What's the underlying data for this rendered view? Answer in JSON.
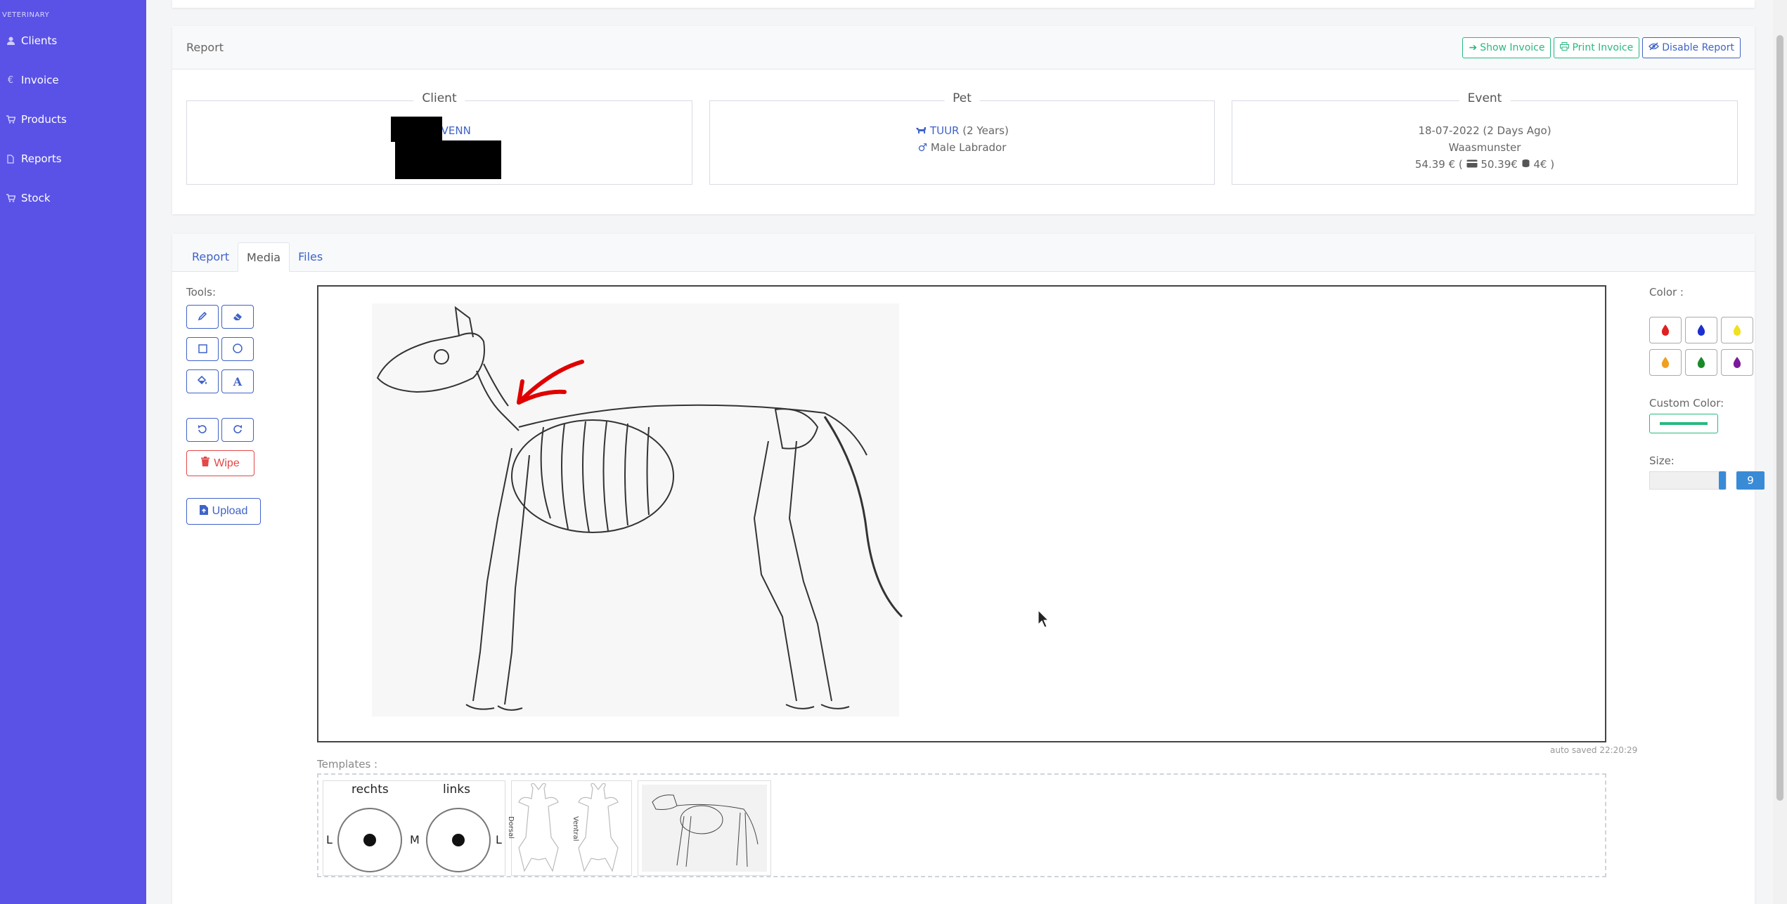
{
  "sidebar": {
    "brand": "VETERINARY",
    "items": [
      {
        "label": "Clients",
        "icon": "user-icon"
      },
      {
        "label": "Invoice",
        "icon": "euro-icon"
      },
      {
        "label": "Products",
        "icon": "cart-icon"
      },
      {
        "label": "Reports",
        "icon": "file-icon"
      },
      {
        "label": "Stock",
        "icon": "cart-icon"
      }
    ]
  },
  "report_card": {
    "title": "Report",
    "buttons": {
      "show_invoice": "Show Invoice",
      "print_invoice": "Print Invoice",
      "disable_report": "Disable Report"
    },
    "client": {
      "legend": "Client",
      "name": "SVENN"
    },
    "pet": {
      "legend": "Pet",
      "name": "TUUR",
      "age": "(2 Years)",
      "description": "Male Labrador"
    },
    "event": {
      "legend": "Event",
      "date": "18-07-2022 (2 Days Ago)",
      "location": "Waasmunster",
      "total": "54.39 €",
      "paid_card": "50.39€",
      "paid_cash": "4€"
    }
  },
  "tabs": [
    "Report",
    "Media",
    "Files"
  ],
  "active_tab": "Media",
  "tools": {
    "label": "Tools:",
    "wipe": "Wipe",
    "upload": "Upload"
  },
  "canvas": {
    "auto_saved": "auto saved 22:20:29"
  },
  "templates": {
    "label": "Templates :",
    "eye_template": {
      "right": "rechts",
      "left": "links",
      "l1": "L",
      "m": "M",
      "l2": "L"
    },
    "body_template": {
      "dorsal": "Dorsal",
      "ventral": "Ventral"
    }
  },
  "colors": {
    "label": "Color :",
    "swatches": [
      "#e02020",
      "#1c2fd0",
      "#f0e020",
      "#f0a020",
      "#1a8a2a",
      "#7a1a9a"
    ],
    "custom_label": "Custom Color:",
    "custom_value": "#28b980"
  },
  "size": {
    "label": "Size:",
    "value": "9"
  },
  "accent": "#5a52e6"
}
